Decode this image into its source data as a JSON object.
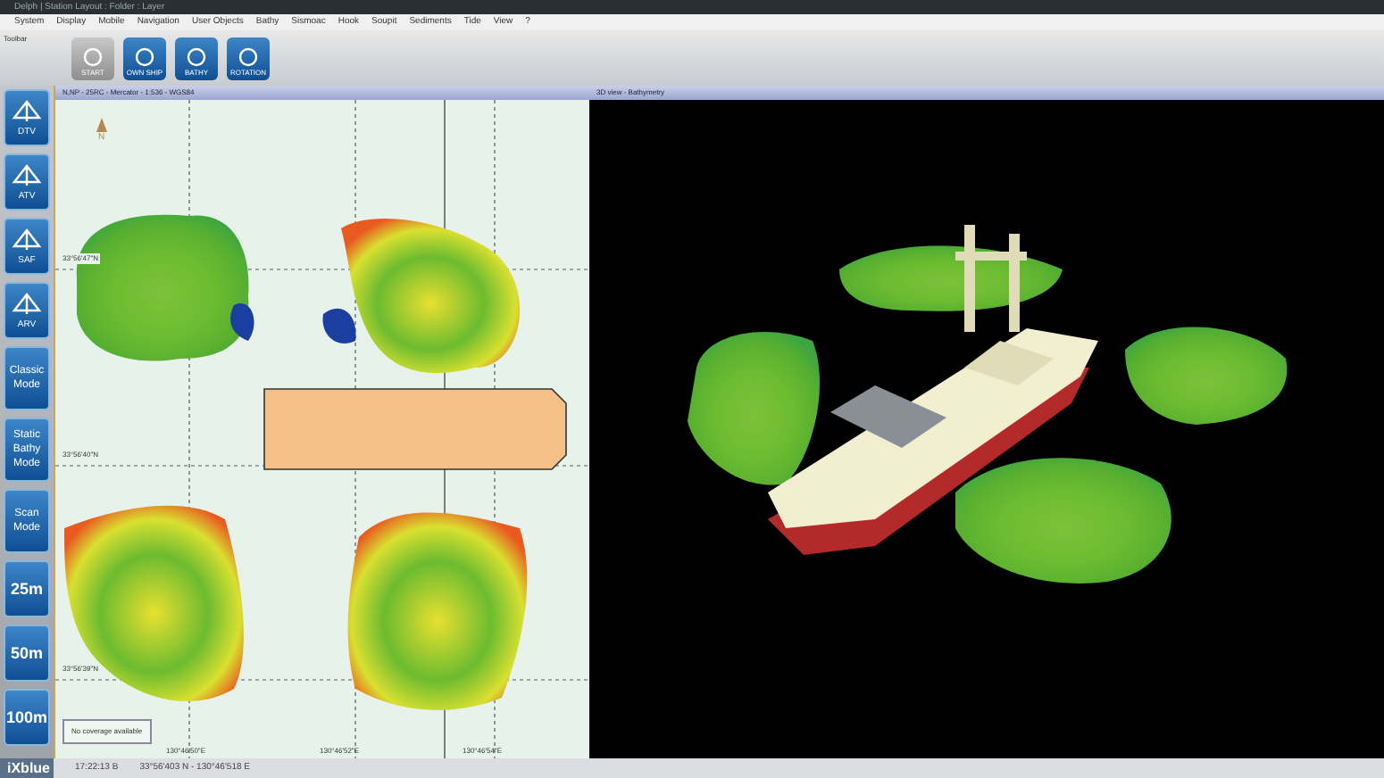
{
  "window": {
    "title": "Delph | Station Layout : Folder : Layer"
  },
  "menu": [
    "System",
    "Display",
    "Mobile",
    "Navigation",
    "User Objects",
    "Bathy",
    "Sismoac",
    "Hook",
    "Soupit",
    "Sediments",
    "Tide",
    "View",
    "?"
  ],
  "toolbar": {
    "title": "Toolbar",
    "buttons": [
      {
        "label": "START",
        "disabled": true
      },
      {
        "label": "OWN SHIP",
        "disabled": false
      },
      {
        "label": "BATHY",
        "disabled": false
      },
      {
        "label": "ROTATION",
        "disabled": false
      }
    ]
  },
  "sidebar": {
    "buttons": [
      {
        "kind": "icon",
        "label": "DTV"
      },
      {
        "kind": "icon",
        "label": "ATV"
      },
      {
        "kind": "icon",
        "label": "SAF"
      },
      {
        "kind": "icon",
        "label": "ARV"
      },
      {
        "kind": "text",
        "label": "Classic Mode"
      },
      {
        "kind": "text",
        "label": "Static Bathy Mode"
      },
      {
        "kind": "text",
        "label": "Scan Mode"
      },
      {
        "kind": "range",
        "label": "25m"
      },
      {
        "kind": "range",
        "label": "50m"
      },
      {
        "kind": "range",
        "label": "100m"
      }
    ]
  },
  "map": {
    "title": "N,NP - 25RC - Mercator - 1:536 - WGS84",
    "north": "N",
    "latitudes": [
      "33°56'47\"N",
      "33°56'40\"N",
      "33°56'39\"N"
    ],
    "longitudes": [
      "130°46'50\"E",
      "130°46'52\"E",
      "130°46'54\"E"
    ],
    "notice": "No coverage available"
  },
  "view3d": {
    "title": "3D view - Bathymetry"
  },
  "status_bar": {
    "logo": "iXblue",
    "time": "17:22:13 B",
    "position": "33°56'403 N - 130°46'518 E"
  }
}
